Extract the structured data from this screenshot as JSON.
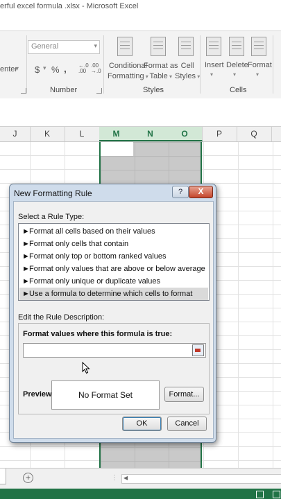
{
  "window": {
    "title": "erful excel formula .xlsx - Microsoft Excel"
  },
  "ribbon": {
    "alignment_partial_label": "enter",
    "number": {
      "format_value": "General",
      "symbols": [
        "$",
        "%",
        ","
      ],
      "group_label": "Number"
    },
    "styles": {
      "conditional_formatting": [
        "Conditional",
        "Formatting"
      ],
      "format_as_table": [
        "Format as",
        "Table"
      ],
      "cell_styles": [
        "Cell",
        "Styles"
      ],
      "group_label": "Styles"
    },
    "cells": {
      "insert": "Insert",
      "delete": "Delete",
      "format": "Format",
      "group_label": "Cells"
    }
  },
  "columns": [
    "J",
    "K",
    "L",
    "M",
    "N",
    "O",
    "P",
    "Q"
  ],
  "dialog": {
    "title": "New Formatting Rule",
    "help": "?",
    "close": "X",
    "select_rule_type_label": "Select a Rule Type:",
    "rule_types": [
      "Format all cells based on their values",
      "Format only cells that contain",
      "Format only top or bottom ranked values",
      "Format only values that are above or below average",
      "Format only unique or duplicate values",
      "Use a formula to determine which cells to format"
    ],
    "selected_rule_index": 5,
    "edit_description_label": "Edit the Rule Description:",
    "formula_label": "Format values where this formula is true:",
    "formula_value": "",
    "preview_label": "Preview:",
    "preview_text": "No Format Set",
    "format_button": "Format...",
    "ok_button": "OK",
    "cancel_button": "Cancel"
  }
}
